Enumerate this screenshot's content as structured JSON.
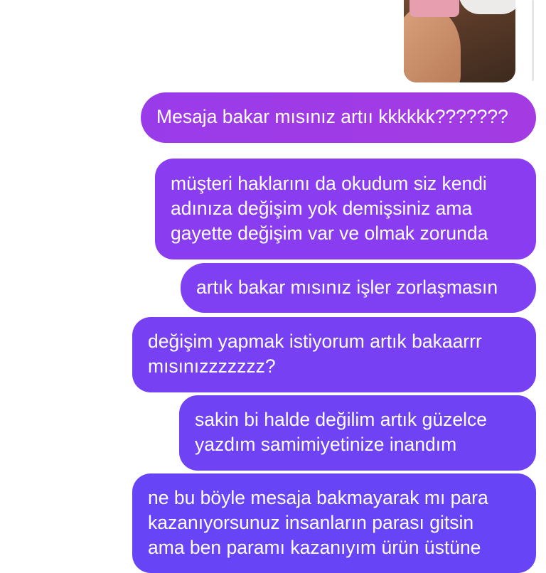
{
  "conversation": {
    "image_message": {
      "alt": "shared photo"
    },
    "messages": [
      {
        "lines": [
          "Mesaja bakar mısınız artıı kkkkkk???????"
        ]
      },
      {
        "lines": [
          "müşteri haklarını da okudum siz kendi",
          "adınıza değişim yok demişsiniz ama",
          "gayette değişim var ve olmak zorunda"
        ]
      },
      {
        "lines": [
          "artık bakar mısınız işler zorlaşmasın"
        ]
      },
      {
        "lines": [
          "değişim yapmak istiyorum artık bakaarrr",
          "mısınızzzzzzz?"
        ]
      },
      {
        "lines": [
          "sakin bi halde değilim artık güzelce",
          "yazdım samimiyetinize inandım"
        ]
      },
      {
        "lines": [
          "ne bu böyle mesaja bakmayarak mı para",
          "kazanıyorsunuz insanların parası gitsin",
          "ama ben paramı kazanıyım ürün üstüne"
        ]
      }
    ]
  },
  "colors": {
    "bubble_top": "#9a3bea",
    "bubble_bottom": "#6744f5",
    "text": "#ffffff"
  }
}
